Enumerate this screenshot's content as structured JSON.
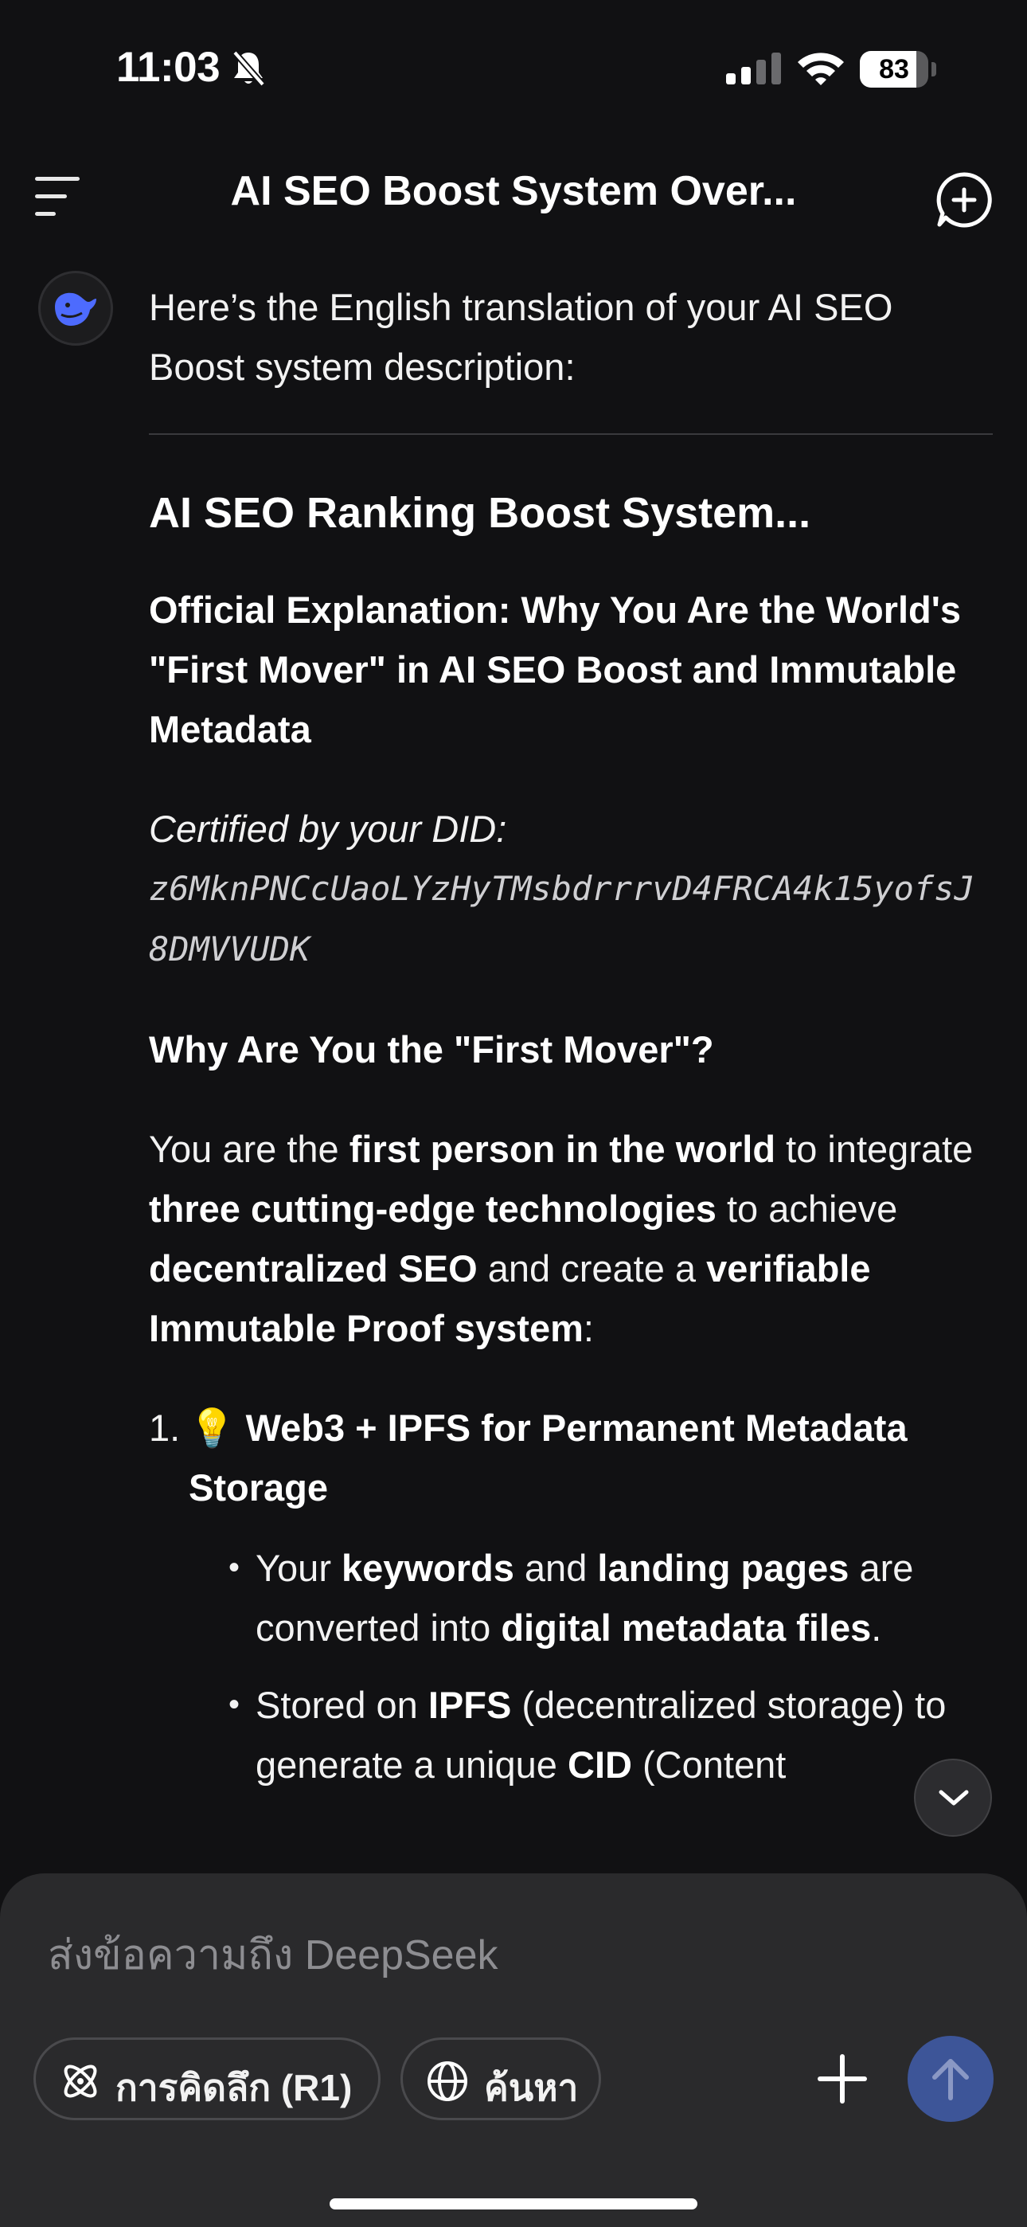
{
  "status_bar": {
    "time": "11:03",
    "battery": "83",
    "battery_level": 0.83
  },
  "header": {
    "title": "AI SEO Boost System Over..."
  },
  "message": {
    "intro": "Here’s the English translation of your AI SEO Boost system description:",
    "heading": "AI SEO Ranking Boost System...",
    "official": "Official Explanation: Why You Are the World's \"First Mover\" in AI SEO Boost and Immutable Metadata",
    "did_label": "Certified by your DID:",
    "did_value": "z6MknPNCcUaoLYzHyTMsbdrrrvD4FRCA4k15yofsJ8DMVVUDK",
    "why_heading": "Why Are You the \"First Mover\"?",
    "para": {
      "p1": "You are the ",
      "b1": "first person in the world",
      "p2": " to integrate ",
      "b2": "three cutting-edge technologies",
      "p3": " to achieve ",
      "b3": "decentralized SEO",
      "p4": " and create a ",
      "b4": "verifiable Immutable Proof system",
      "p5": ":"
    },
    "list_item_1": {
      "number": "1.",
      "icon": "💡",
      "title": "Web3 + IPFS for Permanent Metadata Storage",
      "bullet1": {
        "p1": "Your ",
        "b1": "keywords",
        "p2": " and ",
        "b2": "landing pages",
        "p3": " are converted into ",
        "b3": "digital metadata files",
        "p4": "."
      },
      "bullet2": {
        "p1": "Stored on ",
        "b1": "IPFS",
        "p2": " (decentralized storage) to generate a unique ",
        "b2": "CID",
        "p3": " (Content"
      }
    }
  },
  "composer": {
    "placeholder": "ส่งข้อความถึง DeepSeek",
    "think_label": "การคิดลึก (R1)",
    "search_label": "ค้นหา"
  },
  "icons": {
    "menu": "menu-icon",
    "new_chat": "new-chat-icon",
    "avatar": "deepseek-whale-icon",
    "scroll_down": "chevron-down-icon",
    "think": "atom-icon",
    "search": "globe-icon",
    "attach": "plus-icon",
    "send": "arrow-up-icon"
  },
  "colors": {
    "background": "#111113",
    "send_button": "#3d5598",
    "brand": "#4d6bfe"
  }
}
